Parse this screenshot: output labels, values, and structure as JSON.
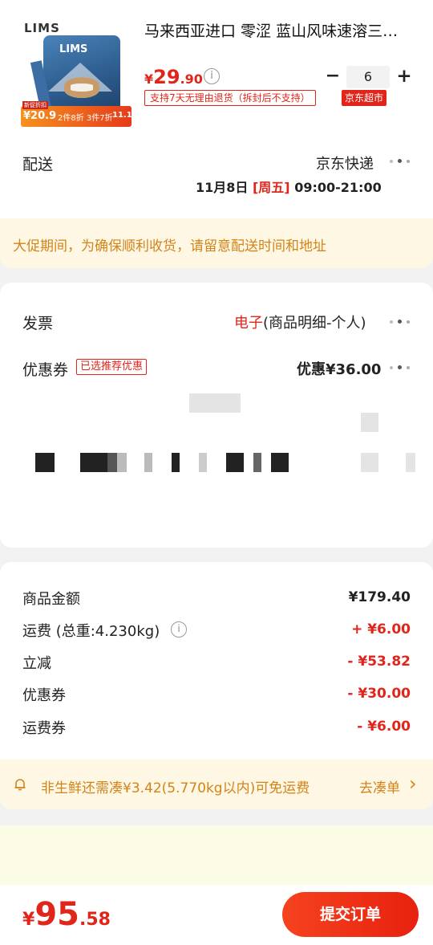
{
  "product": {
    "brand": "LIMS",
    "package_brand": "LIMS",
    "promo_tag_top": "新促折扣",
    "promo_price": "¥20.9",
    "promo_text": "2件8折 3件7折",
    "promo_badge": "11.11",
    "title": "马来西亚进口 零涩 蓝山风味速溶三…",
    "price_symbol": "¥",
    "price_int": "29",
    "price_dec": ".90",
    "return_tag": "支持7天无理由退货（拆封后不支持）",
    "store_tag": "京东超市",
    "qty_minus": "−",
    "qty_value": "6",
    "qty_plus": "+"
  },
  "delivery": {
    "label": "配送",
    "carrier": "京东快递",
    "date": "11月8日",
    "weekday": "[周五]",
    "time": "09:00-21:00"
  },
  "notice": {
    "text": "大促期间，为确保顺利收货，请留意配送时间和地址"
  },
  "invoice": {
    "label": "发票",
    "value_highlight": "电子",
    "value_rest": "(商品明细-个人)"
  },
  "coupon": {
    "label": "优惠券",
    "tag": "已选推荐优惠",
    "value": "优惠¥36.00"
  },
  "summary": {
    "rows": [
      {
        "label": "商品金额",
        "value": "¥179.40"
      },
      {
        "label": "运费 (总重:4.230kg)",
        "value": "+ ¥6.00"
      },
      {
        "label": "立减",
        "value": "- ¥53.82"
      },
      {
        "label": "优惠券",
        "value": "- ¥30.00"
      },
      {
        "label": "运费券",
        "value": "- ¥6.00"
      }
    ]
  },
  "freight_tip": {
    "text": "非生鲜还需凑¥3.42(5.770kg以内)可免运费",
    "action": "去凑单",
    "chevron": "›"
  },
  "footer": {
    "currency": "¥",
    "total_int": "95",
    "total_dec": ".58",
    "submit": "提交订单"
  },
  "colors": {
    "accent_red": "#e1251b",
    "notice_bg": "#fdf7e3",
    "notice_text": "#d4831a",
    "submit_bg": "#f02b1a"
  }
}
